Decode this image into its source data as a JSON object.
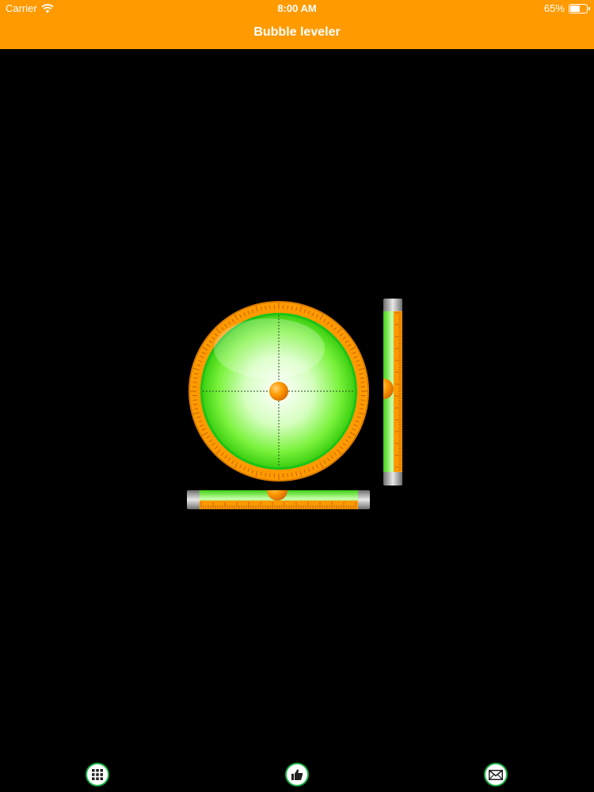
{
  "status_bar": {
    "carrier": "Carrier",
    "time": "8:00 AM",
    "battery": "65%",
    "battery_level": 0.65
  },
  "nav": {
    "title": "Bubble leveler"
  },
  "leveler": {
    "circular_bubble": {
      "x_offset": 0,
      "y_offset": 0
    },
    "vertical_bubble": {
      "offset": 0
    },
    "horizontal_bubble": {
      "offset": 0
    }
  },
  "bottom_bar": {
    "buttons": [
      {
        "icon": "grid-icon"
      },
      {
        "icon": "thumbs-up-icon"
      },
      {
        "icon": "mail-icon"
      }
    ]
  },
  "colors": {
    "header": "#ff9a00",
    "accent_green": "#18b044",
    "liquid": "#5eee24",
    "bubble": "#ff9500"
  }
}
